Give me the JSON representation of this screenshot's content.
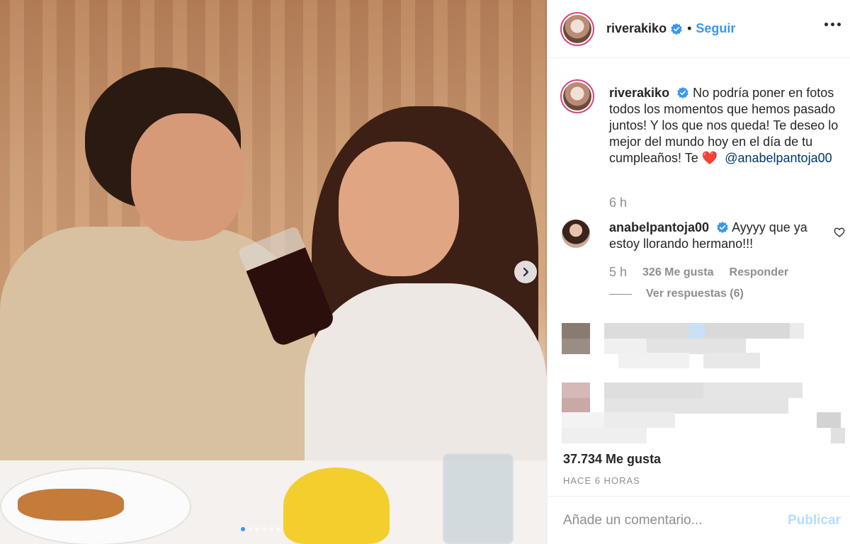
{
  "post": {
    "username": "riverakiko",
    "follow_label": "Seguir",
    "bullet": "•",
    "caption_before_mention": "No podría poner en fotos todos los momentos que hemos pasado juntos! Y los que nos queda! Te deseo lo mejor del mundo hoy en el día de tu cumpleaños! Te",
    "caption_emoji": "❤️",
    "caption_mention": "@anabelpantoja00",
    "caption_time": "6 h",
    "likes": "37.734 Me gusta",
    "posted_ago": "HACE 6 HORAS"
  },
  "comment": {
    "username": "anabelpantoja00",
    "text": "Ayyyy que ya estoy llorando hermano!!!",
    "time": "5 h",
    "likes": "326 Me gusta",
    "reply_label": "Responder",
    "view_replies": "Ver respuestas (6)"
  },
  "composer": {
    "placeholder": "Añade un comentario...",
    "publish_label": "Publicar"
  },
  "carousel": {
    "slides": 6,
    "active": 1
  },
  "colors": {
    "link_blue": "#3897f0",
    "mention_blue": "#00376b",
    "muted": "#8e8e8e",
    "publish_disabled": "#b2dffc",
    "story_ring": "#d7467f"
  },
  "icons": [
    "verified-badge-icon",
    "more-options-icon",
    "chevron-right-icon",
    "heart-outline-icon"
  ]
}
